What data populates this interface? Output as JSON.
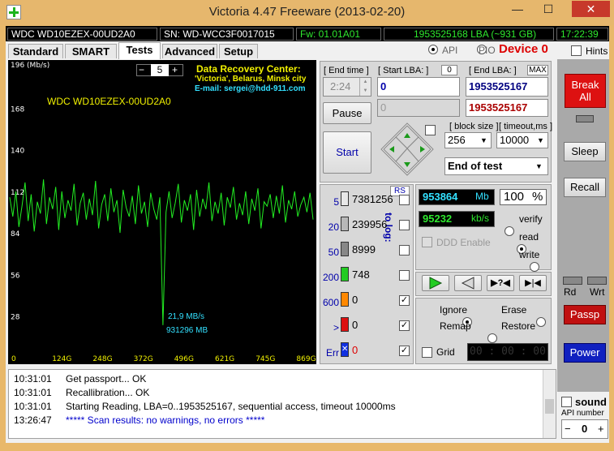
{
  "window": {
    "title": "Victoria 4.47  Freeware (2013-02-20)",
    "minimize": "—",
    "maximize": "☐",
    "close": "✕"
  },
  "infobar": {
    "model": "WDC WD10EZEX-00UD2A0",
    "serial": "SN: WD-WCC3F0017015",
    "firmware": "Fw: 01.01A01",
    "lba": "1953525168 LBA (~931 GB)",
    "clock": "17:22:39"
  },
  "topright": {
    "api_label": "API",
    "pio_label": "PIO",
    "device": "Device 0",
    "hints": "Hints"
  },
  "tabs": [
    "Standard",
    "SMART",
    "Tests",
    "Advanced",
    "Setup"
  ],
  "graph": {
    "ylabel": "196 (Mb/s)",
    "yticks": [
      "168",
      "140",
      "112",
      "84",
      "56",
      "28"
    ],
    "xticks": [
      "0",
      "124G",
      "248G",
      "372G",
      "496G",
      "621G",
      "745G",
      "869G"
    ],
    "drive_label": "WDC WD10EZEX-00UD2A0",
    "spinner_value": "5",
    "minus": "−",
    "plus": "+",
    "drc_title": "Data Recovery Center:",
    "drc_line1": "'Victoria', Belarus, Minsk city",
    "drc_line2": "E-mail: sergei@hdd-911.com",
    "speed_readout": "21,9 MB/s",
    "pos_readout": "931296 MB"
  },
  "chart_data": {
    "type": "line",
    "title": "",
    "xlabel": "",
    "ylabel": "(Mb/s)",
    "ylim": [
      0,
      196
    ],
    "x_ticks": [
      "0",
      "124G",
      "248G",
      "372G",
      "496G",
      "621G",
      "745G",
      "869G"
    ],
    "series": [
      {
        "values": [
          108,
          95,
          112,
          88,
          102,
          118,
          92,
          110,
          85,
          105,
          97,
          120,
          90,
          108,
          100,
          115,
          86,
          112,
          94,
          106,
          99,
          117,
          89,
          104,
          111,
          93,
          107,
          96,
          119,
          87,
          103,
          110,
          92,
          114,
          98,
          106,
          84,
          113,
          101,
          95,
          109,
          90,
          116,
          97,
          105,
          88,
          111,
          100,
          93,
          108,
          21.9,
          98,
          112,
          94,
          104,
          117,
          91,
          106,
          99,
          110,
          86,
          113,
          95,
          107,
          100,
          118,
          92,
          105,
          97,
          111,
          89,
          108,
          101,
          115,
          93,
          104,
          96,
          112,
          90,
          107,
          99,
          114,
          87,
          105,
          102,
          110,
          94,
          109,
          97,
          116,
          91,
          106,
          100,
          112,
          95,
          103,
          108,
          98,
          111,
          93
        ]
      }
    ]
  },
  "controls": {
    "end_time_label": "[ End time ]",
    "end_time_value": "2:24",
    "start_lba_label": "[ Start LBA: ]",
    "start_lba_zero": "0",
    "start_lba_value": "0",
    "end_lba_label": "[ End LBA: ]",
    "end_lba_max": "MAX",
    "end_lba_value": "1953525167",
    "pause_label": "Pause",
    "pause_field": "0",
    "current_lba": "1953525167",
    "start_label": "Start",
    "block_size_label": "[ block size ]",
    "block_size_value": "256",
    "timeout_label": "[ timeout,ms ]",
    "timeout_value": "10000",
    "end_action": "End of test"
  },
  "stats": {
    "rs_label": "RS",
    "to_log": "to log:",
    "rows": [
      {
        "ms": "5",
        "count": "7381256",
        "color": "#e8e8e8",
        "checked": false
      },
      {
        "ms": "20",
        "count": "239956",
        "color": "#b8b8b8",
        "checked": false
      },
      {
        "ms": "50",
        "count": "8999",
        "color": "#888888",
        "checked": false
      },
      {
        "ms": "200",
        "count": "748",
        "color": "#22cc22",
        "checked": false
      },
      {
        "ms": "600",
        "count": "0",
        "color": "#ff8800",
        "checked": true
      },
      {
        "ms": ">",
        "count": "0",
        "color": "#dd1111",
        "checked": true
      },
      {
        "ms": "Err",
        "count": "0",
        "color": "#1030e0",
        "checked": true
      }
    ]
  },
  "readouts": {
    "mb_value": "953864",
    "mb_unit": "Mb",
    "percent_value": "100",
    "percent_unit": "%",
    "kbs_value": "95232",
    "kbs_unit": "kb/s",
    "ddd_label": "DDD Enable",
    "verify": "verify",
    "read": "read",
    "write": "write"
  },
  "actions": {
    "ignore": "Ignore",
    "erase": "Erase",
    "remap": "Remap",
    "restore": "Restore",
    "grid": "Grid",
    "timer": "00 : 00 : 00"
  },
  "sidebar": {
    "break_all": "Break\nAll",
    "sleep": "Sleep",
    "recall": "Recall",
    "rd": "Rd",
    "wrt": "Wrt",
    "passp": "Passp",
    "power": "Power",
    "sound": "sound",
    "api_number": "API number",
    "api_minus": "−",
    "api_value": "0",
    "api_plus": "+"
  },
  "log": [
    {
      "time": "10:31:01",
      "text": "Get passport... OK",
      "color": "#000"
    },
    {
      "time": "10:31:01",
      "text": "Recallibration... OK",
      "color": "#000"
    },
    {
      "time": "10:31:01",
      "text": "Starting Reading, LBA=0..1953525167, sequential access, timeout 10000ms",
      "color": "#000"
    },
    {
      "time": "13:26:47",
      "text": "***** Scan results: no warnings, no errors *****",
      "color": "#0000cc"
    }
  ],
  "colors": {
    "accent_red": "#cc0000",
    "graph_green": "#22ee22",
    "graph_text_yellow": "#f0f000",
    "graph_cyan": "#33e0ff"
  }
}
